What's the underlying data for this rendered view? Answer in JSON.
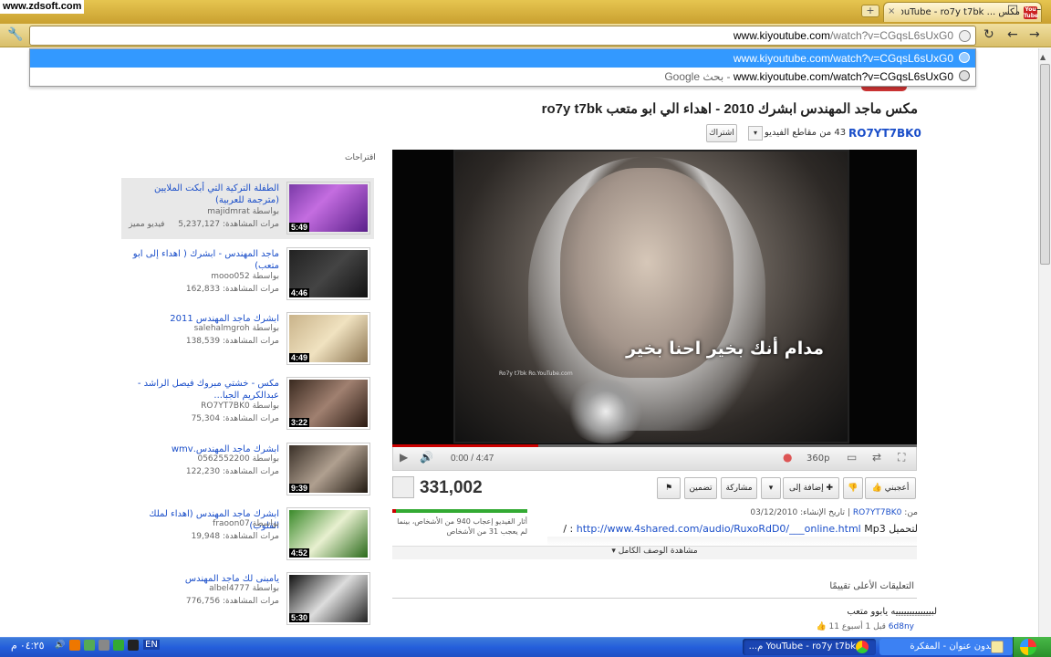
{
  "watermark": "www.zdsoft.com",
  "browser": {
    "tab_title": "مكس ... YouTube - ro7y t7bk",
    "tab_favicon": "You Tube",
    "tab_close": "×",
    "new_tab": "+",
    "url_host": "www.kiyoutube.com",
    "url_rest": "/watch?v=CGqsL6sUxG0",
    "dropdown_selected": "www.kiyoutube.com/watch?v=CGqsL6sUxG0",
    "dropdown_url": "www.kiyoutube.com/watch?v=CGqsL6sUxG0",
    "dropdown_search": "Google بحث - ",
    "minimize": "–",
    "maximize": "□",
    "close": "✕"
  },
  "video": {
    "title": "مكس ماجد المهندس ابشرك 2010 - اهداء الي ابو متعب ro7y t7bk",
    "channel": "RO7YT7BK0",
    "video_count": "43 من مقاطع الفيديو",
    "subscribe": "اشتراك",
    "frame_text": "مدام أنك بخير احنا بخير",
    "frame_logo": "Ro7y t7bk\nRo.YouTube.com",
    "time": "0:00 / 4:47",
    "quality": "360p",
    "views": "331,002",
    "like": "أعجبني",
    "add_to": "إضافة إلى",
    "share": "مشاركة",
    "embed": "تضمين",
    "meta_from": "من:",
    "meta_user": "RO7YT7BK0",
    "meta_date": "| تاريخ الإنشاء: 03/12/2010",
    "mp3_label": "لتحميل",
    "mp3_link": "http://www.4shared.com/audio/RuxoRdD0/___online.html",
    "mp3_suffix": "Mp3 : /",
    "more": "مشاهدة الوصف الكامل",
    "like_text": "أثار الفيديو إعجاب 940 من الأشخاص، بينما لم يعجب 31 من الأشخاص"
  },
  "sidebar": {
    "header": "اقتراحات",
    "items": [
      {
        "title": "الطفلة التركية التي أبكت الملايين (مترجمة للعربية)",
        "by": "بواسطة majidmrat",
        "views": "مرات المشاهدة: 5,237,127",
        "hd": "فيديو مميز",
        "duration": "5:49"
      },
      {
        "title": "ماجد المهندس - ابشرك ( اهداء إلى ابو متعب)",
        "by": "بواسطة mooo052",
        "views": "مرات المشاهدة: 162,833",
        "hd": "",
        "duration": "4:46"
      },
      {
        "title": "ابشرك ماجد المهندس 2011",
        "by": "بواسطة salehalmgroh",
        "views": "مرات المشاهدة: 138,539",
        "hd": "",
        "duration": "4:49"
      },
      {
        "title": "مكس - خشتي مبروك فيصل الراشد - عبدالكريم الجبا...",
        "by": "بواسطة RO7YT7BK0",
        "views": "مرات المشاهدة: 75,304",
        "hd": "",
        "duration": "3:22"
      },
      {
        "title": "ابشرك ماجد المهندس.wmv",
        "by": "بواسطة 0562552200",
        "views": "مرات المشاهدة: 122,230",
        "hd": "",
        "duration": "9:39"
      },
      {
        "title": "ابشرك ماجد المهندس (اهداء لملك القلوب)",
        "by": "بواسطة fraoon07",
        "views": "مرات المشاهدة: 19,948",
        "hd": "",
        "duration": "4:52"
      },
      {
        "title": "يامبنى لك ماجد المهندس",
        "by": "بواسطة albel4777",
        "views": "مرات المشاهدة: 776,756",
        "hd": "",
        "duration": "5:30"
      }
    ]
  },
  "comments": {
    "title": "التعليقات الأعلى تقييمًا",
    "text": "لبيييييييييييييه يابوو متعب",
    "meta_user": "6d8ny",
    "meta_time": "قبل 1 أسبوع 11"
  },
  "taskbar": {
    "clock": "٠٤:٢٥ م",
    "lang": "EN",
    "task1": "YouTube - ro7y t7bk م...",
    "task2": "بدون عنوان - المفكرة"
  },
  "colors": {
    "accent": "#1a4ec9",
    "chrome": "#d6b33b",
    "select": "#3399ff",
    "taskbar": "#245edb"
  }
}
